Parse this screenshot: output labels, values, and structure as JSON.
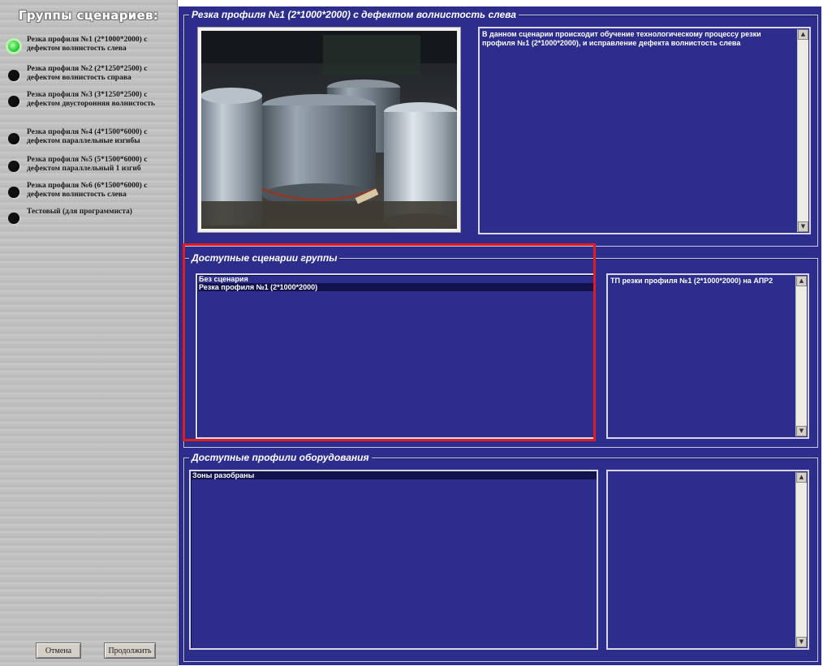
{
  "sidebar": {
    "title": "Группы сценариев:",
    "groups": [
      {
        "label": "Резка профиля №1 (2*1000*2000) с дефектом волнистость слева",
        "active": true
      },
      {
        "label": "Резка профиля №2 (2*1250*2500) с дефектом волнистость справа",
        "active": false
      },
      {
        "label": "Резка профиля №3 (3*1250*2500) с дефектом двусторонняя волнистость",
        "active": false
      },
      {
        "label": "Резка профиля №4 (4*1500*6000) с дефектом параллельные изгибы",
        "active": false
      },
      {
        "label": "Резка профиля №5 (5*1500*6000) с дефектом параллельный 1 изгиб",
        "active": false
      },
      {
        "label": "Резка профиля №6 (6*1500*6000) с дефектом волнистость слева",
        "active": false
      },
      {
        "label": "Тестовый (для программиста)",
        "active": false
      }
    ],
    "cancel_label": "Отмена",
    "continue_label": "Продолжить"
  },
  "scenario_group": {
    "title": "Резка профиля №1 (2*1000*2000) с дефектом волнистость слева",
    "description": "В данном сценарии происходит обучение технологическому процессу резки профиля №1 (2*1000*2000), и исправление дефекта волнистость слева"
  },
  "available_scenarios": {
    "title": "Доступные сценарии группы",
    "items": [
      "Без сценария",
      "Резка профиля №1 (2*1000*2000)"
    ],
    "selected_index": 1,
    "detail": "ТП резки профиля №1 (2*1000*2000) на АПР2"
  },
  "equipment_profiles": {
    "title": "Доступные профили оборудования",
    "items": [
      "Зоны разобраны"
    ],
    "selected_index": 0,
    "detail": ""
  },
  "colors": {
    "panel_bg": "#2d2d8c",
    "selection": "#12124d",
    "highlight": "#e11c1c",
    "active_radio": "#35d24a"
  }
}
